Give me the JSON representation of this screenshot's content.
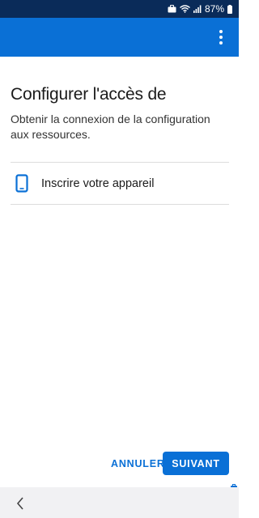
{
  "status_bar": {
    "battery_percent": "87%",
    "icons": [
      "briefcase-icon",
      "wifi-icon",
      "signal-icon",
      "battery-icon"
    ]
  },
  "app_bar": {
    "menu_icon": "more-vert-icon",
    "color": "#0a70d6"
  },
  "main": {
    "title": "Configurer l'accès de",
    "subtitle": "Obtenir la connexion de la configuration aux ressources.",
    "options": [
      {
        "icon": "smartphone-icon",
        "label": "Inscrire votre appareil"
      }
    ]
  },
  "actions": {
    "cancel_label": "ANNULER",
    "next_label": "SUIVANT"
  },
  "nav_bar": {
    "back_icon": "back-chevron-icon"
  },
  "colors": {
    "accent": "#0a70d6",
    "status_bar": "#0a2b59"
  }
}
